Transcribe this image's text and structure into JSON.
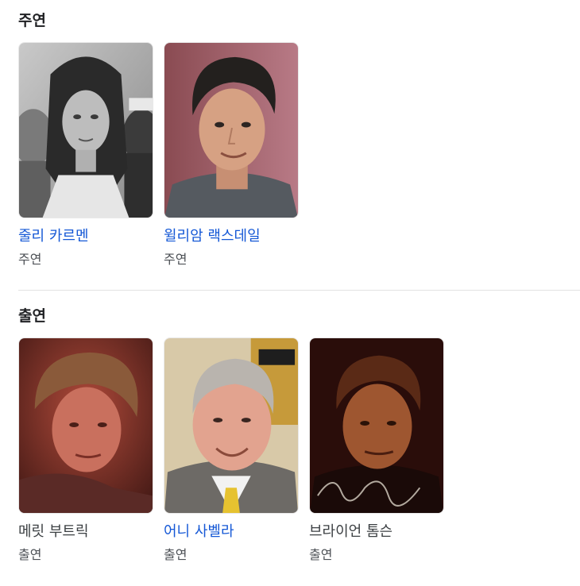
{
  "sections": [
    {
      "title": "주연",
      "people": [
        {
          "name": "줄리 카르멘",
          "role": "주연",
          "linked": true,
          "portrait": "bw-woman"
        },
        {
          "name": "윌리암 랙스데일",
          "role": "주연",
          "linked": true,
          "portrait": "man-dark-hair"
        }
      ]
    },
    {
      "title": "출연",
      "people": [
        {
          "name": "메릿 부트릭",
          "role": "출연",
          "linked": false,
          "portrait": "red-tint-man"
        },
        {
          "name": "어니 사벨라",
          "role": "출연",
          "linked": true,
          "portrait": "older-man-yellow-tie"
        },
        {
          "name": "브라이언 톰슨",
          "role": "출연",
          "linked": false,
          "portrait": "signed-headshot"
        }
      ]
    }
  ],
  "colors": {
    "link": "#1558d6",
    "text": "#3c4043",
    "subtle": "#4d5156",
    "divider": "#e3e3e3"
  }
}
